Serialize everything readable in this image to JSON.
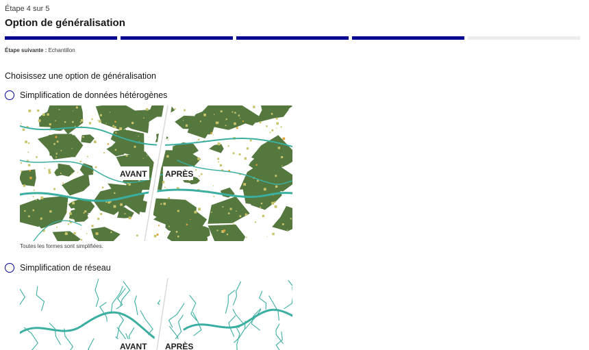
{
  "header": {
    "step_count": "Étape 4 sur 5",
    "title": "Option de généralisation",
    "stepper": {
      "total": 5,
      "completed": 4,
      "accent": "#000091",
      "inactive": "#ececec"
    },
    "next_step_prefix": "Étape suivante :",
    "next_step_value": "Echantillon"
  },
  "form": {
    "legend": "Choisissez une option de généralisation",
    "options": [
      {
        "label": "Simplification de données hétérogènes",
        "selected": false,
        "figure_before": "AVANT",
        "figure_after": "APRÈS",
        "caption": "Toutes les formes sont simplifiées."
      },
      {
        "label": "Simplification de réseau",
        "selected": false,
        "figure_before": "AVANT",
        "figure_after": "APRÈS"
      }
    ]
  },
  "colors": {
    "forest": "#55783f",
    "water": "#3aaea0",
    "settlement": "#c9c46a",
    "highlight": "#e0a43a"
  }
}
